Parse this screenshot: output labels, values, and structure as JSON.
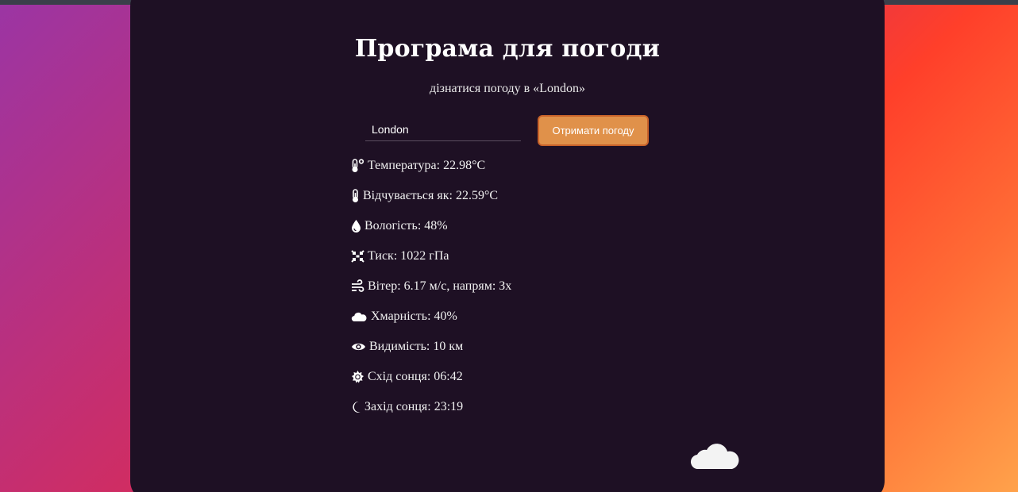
{
  "app": {
    "title": "Програма для погоди",
    "subtitle": "дізнатися погоду в «London»"
  },
  "search": {
    "value": "London",
    "button_label": "Отримати погоду"
  },
  "details": {
    "temperature": {
      "label": "Температура: ",
      "value": "22.98°C",
      "icon": "thermometer-icon"
    },
    "feels_like": {
      "label": "Відчувається як: ",
      "value": "22.59°C",
      "icon": "thermometer-small-icon"
    },
    "humidity": {
      "label": "Вологість: ",
      "value": "48%",
      "icon": "droplet-icon"
    },
    "pressure": {
      "label": "Тиск: ",
      "value": "1022 гПа",
      "icon": "compress-icon"
    },
    "wind": {
      "label": "Вітер: ",
      "value": "6.17 м/с, напрям: Зх",
      "icon": "wind-icon"
    },
    "clouds": {
      "label": "Хмарність: ",
      "value": "40%",
      "icon": "cloud-icon"
    },
    "visibility": {
      "label": "Видимість: ",
      "value": "10 км",
      "icon": "eye-icon"
    },
    "sunrise": {
      "label": "Схід сонця: ",
      "value": "06:42",
      "icon": "sun-icon"
    },
    "sunset": {
      "label": "Захід сонця: ",
      "value": "23:19",
      "icon": "moon-icon"
    }
  },
  "weather_icon": "cloud-icon",
  "colors": {
    "card_background": "#1e1024",
    "button_background": "#e0914a",
    "button_border": "#c8622a",
    "text": "#ffffff"
  }
}
